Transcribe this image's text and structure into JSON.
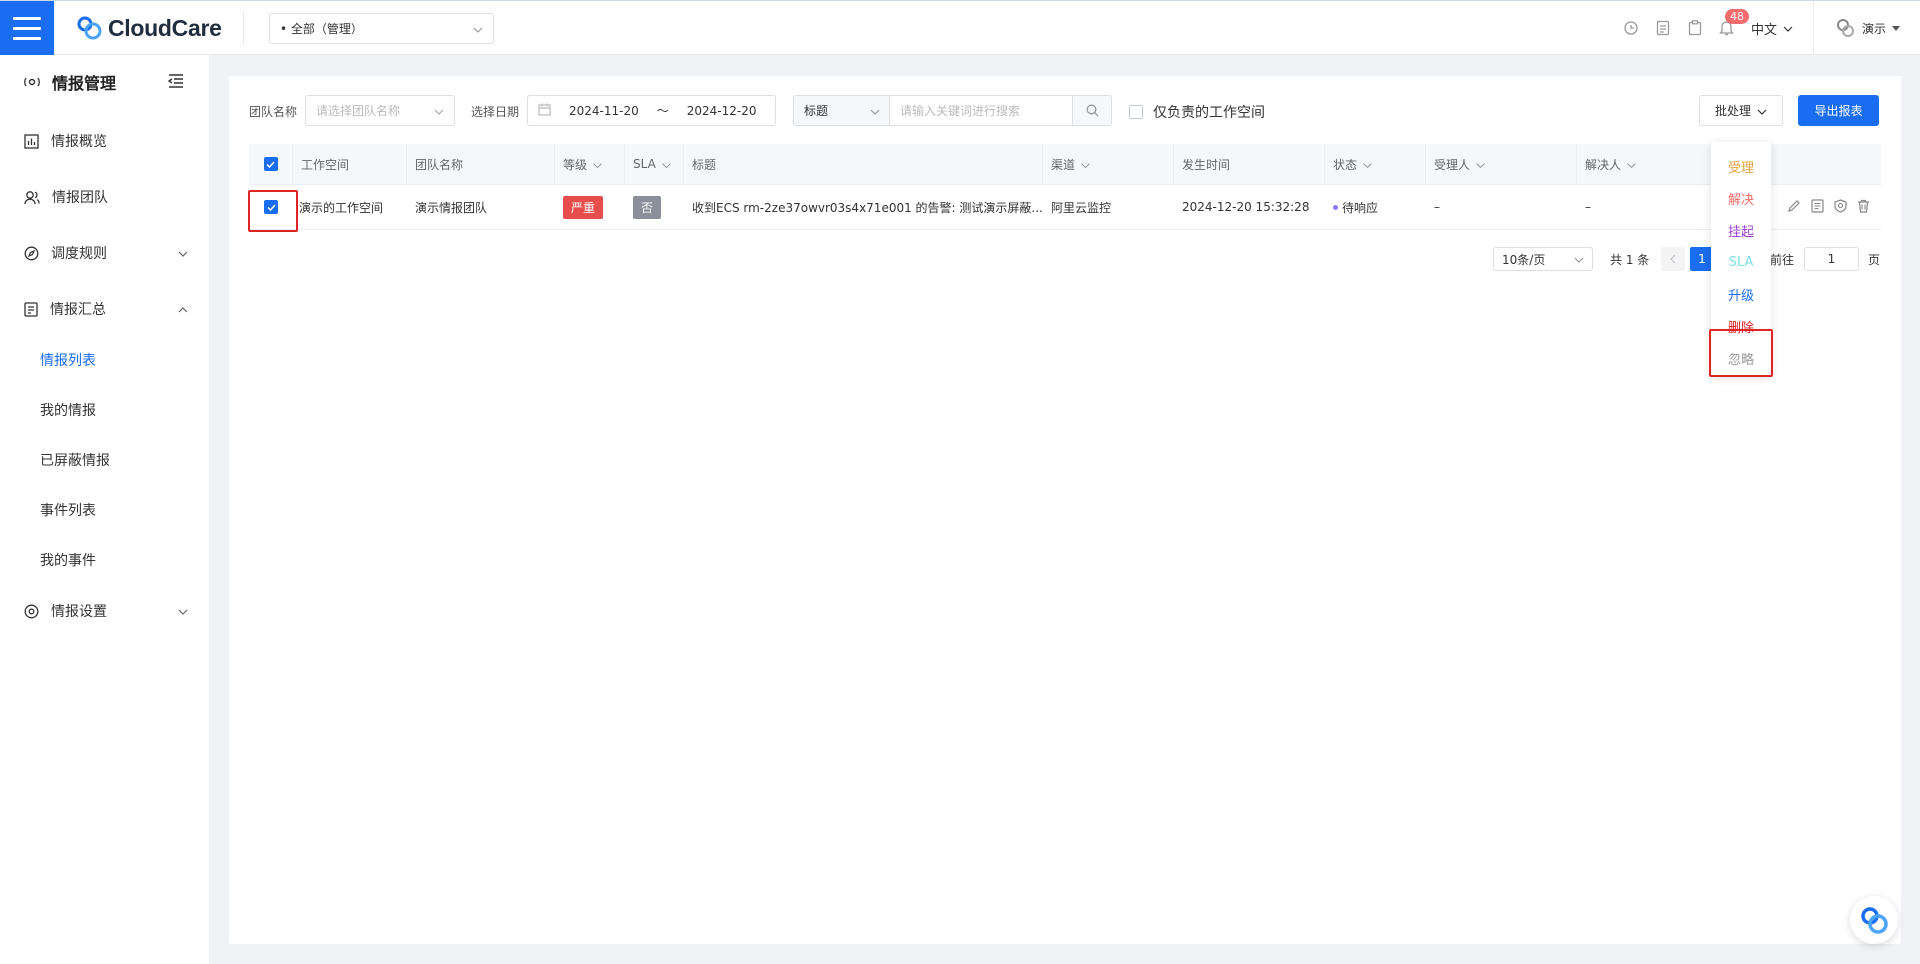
{
  "header": {
    "brand": "CloudCare",
    "workspace": "• 全部（管理）",
    "notification_count": "48",
    "language": "中文",
    "user": "演示"
  },
  "sidebar": {
    "title": "情报管理",
    "items": [
      {
        "label": "情报概览"
      },
      {
        "label": "情报团队"
      },
      {
        "label": "调度规则"
      },
      {
        "label": "情报汇总"
      },
      {
        "label": "情报设置"
      }
    ],
    "sub_items": [
      {
        "label": "情报列表"
      },
      {
        "label": "我的情报"
      },
      {
        "label": "已屏蔽情报"
      },
      {
        "label": "事件列表"
      },
      {
        "label": "我的事件"
      }
    ]
  },
  "filters": {
    "team_label": "团队名称",
    "team_placeholder": "请选择团队名称",
    "date_label": "选择日期",
    "date_start": "2024-11-20",
    "date_sep": "～",
    "date_end": "2024-12-20",
    "search_type": "标题",
    "search_placeholder": "请输入关键词进行搜索",
    "only_mine_label": "仅负责的工作空间",
    "batch_label": "批处理",
    "export_label": "导出报表"
  },
  "table": {
    "columns": [
      "工作空间",
      "团队名称",
      "等级",
      "SLA",
      "标题",
      "渠道",
      "发生时间",
      "状态",
      "受理人",
      "解决人"
    ],
    "rows": [
      {
        "workspace": "演示的工作空间",
        "team": "演示情报团队",
        "level": "严重",
        "sla": "否",
        "title": "收到ECS rm-2ze37owvr03s4x71e001 的告警: 测试演示屏蔽...",
        "channel": "阿里云监控",
        "time": "2024-12-20 15:32:28",
        "status": "待响应",
        "assignee": "–",
        "resolver": "–"
      }
    ]
  },
  "pagination": {
    "page_size": "10条/页",
    "total": "共 1 条",
    "current_page": "1",
    "goto_label": "前往",
    "goto_value": "1",
    "page_unit": "页"
  },
  "dropdown": {
    "items": [
      {
        "label": "受理",
        "color": "#e6a23c"
      },
      {
        "label": "解决",
        "color": "#f56c6c"
      },
      {
        "label": "挂起",
        "color": "#9b3fd1"
      },
      {
        "label": "SLA",
        "color": "#7fe0e6"
      },
      {
        "label": "升级",
        "color": "#1a6df0"
      },
      {
        "label": "删除",
        "color": "#e02424"
      },
      {
        "label": "忽略",
        "color": "#999999"
      }
    ]
  },
  "colors": {
    "primary": "#1a6df0",
    "danger": "#e84d4d",
    "highlight_frame": "#e02424"
  }
}
